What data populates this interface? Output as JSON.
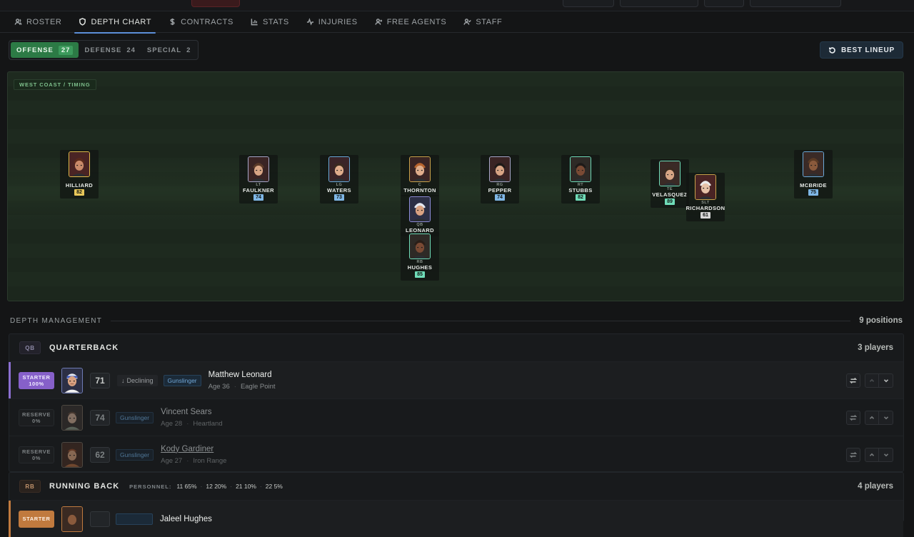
{
  "nav": {
    "tabs": [
      {
        "label": "ROSTER",
        "icon": "users-icon"
      },
      {
        "label": "DEPTH CHART",
        "icon": "shield-icon",
        "active": true
      },
      {
        "label": "CONTRACTS",
        "icon": "dollar-icon"
      },
      {
        "label": "STATS",
        "icon": "bar-chart-icon"
      },
      {
        "label": "INJURIES",
        "icon": "pulse-icon"
      },
      {
        "label": "FREE AGENTS",
        "icon": "user-plus-icon"
      },
      {
        "label": "STAFF",
        "icon": "user-check-icon"
      }
    ]
  },
  "units": {
    "offense": {
      "label": "OFFENSE",
      "count": "27"
    },
    "defense": {
      "label": "DEFENSE",
      "count": "24"
    },
    "special": {
      "label": "SPECIAL",
      "count": "2"
    }
  },
  "best_lineup_label": "BEST LINEUP",
  "field": {
    "scheme": "WEST COAST / TIMING",
    "players": [
      {
        "name": "HILLIARD",
        "pos": "",
        "rating": "82"
      },
      {
        "name": "FAULKNER",
        "pos": "LT",
        "rating": "74"
      },
      {
        "name": "WATERS",
        "pos": "LG",
        "rating": "73"
      },
      {
        "name": "THORNTON",
        "pos": "C",
        "rating": ""
      },
      {
        "name": "PEPPER",
        "pos": "RG",
        "rating": "74"
      },
      {
        "name": "STUBBS",
        "pos": "RT",
        "rating": "82"
      },
      {
        "name": "VELASQUEZ",
        "pos": "TE",
        "rating": "89"
      },
      {
        "name": "RICHARDSON",
        "pos": "SLT",
        "rating": "61"
      },
      {
        "name": "MCBRIDE",
        "pos": "",
        "rating": "75"
      },
      {
        "name": "LEONARD",
        "pos": "QB",
        "rating": ""
      },
      {
        "name": "HUGHES",
        "pos": "RB",
        "rating": "85"
      }
    ]
  },
  "depth": {
    "title": "DEPTH MANAGEMENT",
    "count": "9 positions",
    "qb": {
      "chip": "QB",
      "title": "QUARTERBACK",
      "players_count": "3 players",
      "rows": [
        {
          "role": "STARTER",
          "pct": "100%",
          "ovr": "71",
          "trend": "Declining",
          "archetype": "Gunslinger",
          "name": "Matthew Leonard",
          "age": "Age 36",
          "hometown": "Eagle Point"
        },
        {
          "role": "RESERVE",
          "pct": "0%",
          "ovr": "74",
          "archetype": "Gunslinger",
          "name": "Vincent Sears",
          "age": "Age 28",
          "hometown": "Heartland"
        },
        {
          "role": "RESERVE",
          "pct": "0%",
          "ovr": "62",
          "archetype": "Gunslinger",
          "name": "Kody Gardiner",
          "age": "Age 27",
          "hometown": "Iron Range"
        }
      ]
    },
    "rb": {
      "chip": "RB",
      "title": "RUNNING BACK",
      "personnel_label": "PERSONNEL:",
      "personnel": [
        "11 65%",
        "12 20%",
        "21 10%",
        "22 5%"
      ],
      "players_count": "4 players",
      "rows": [
        {
          "role": "STARTER",
          "name": "Jaleel Hughes"
        }
      ]
    }
  },
  "colors": {
    "accent_green": "#2c7a45",
    "starter_purple": "#8660c9",
    "rb_orange": "#c07a3e",
    "rating_gold": "#e8c85a",
    "rating_blue": "#7fb7e6",
    "rating_teal": "#6fdcb8"
  }
}
